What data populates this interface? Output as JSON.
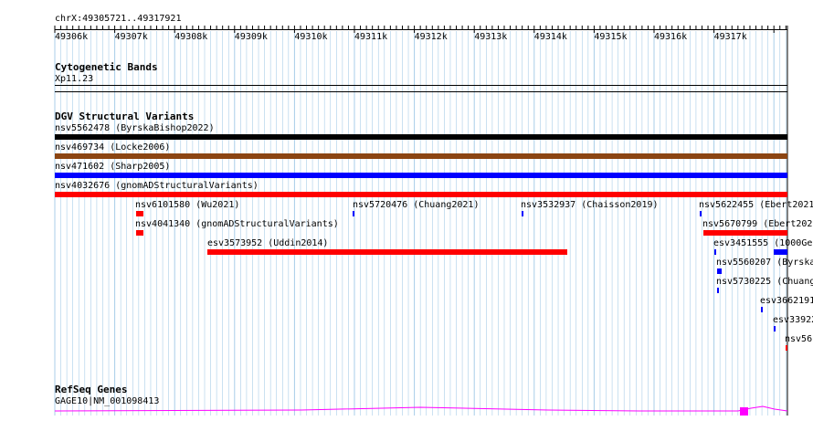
{
  "location": "chrX:49305721..49317921",
  "ruler": {
    "labels": [
      "49306k",
      "49307k",
      "49308k",
      "49309k",
      "49310k",
      "49311k",
      "49312k",
      "49313k",
      "49314k",
      "49315k",
      "49316k",
      "49317k"
    ]
  },
  "tracks": {
    "cytoband": {
      "title": "Cytogenetic Bands",
      "band": "Xp11.23"
    },
    "dgv": {
      "title": "DGV Structural Variants",
      "features": [
        {
          "id": "dgv-1",
          "label": "nsv5562478 (ByrskaBishop2022)",
          "color": "#000000"
        },
        {
          "id": "dgv-2",
          "label": "nsv469734 (Locke2006)",
          "color": "#8b4513"
        },
        {
          "id": "dgv-3",
          "label": "nsv471602 (Sharp2005)",
          "color": "#0000ff"
        },
        {
          "id": "dgv-4",
          "label": "nsv4032676 (gnomADStructuralVariants)",
          "color": "#ff0000"
        },
        {
          "id": "dgv-5",
          "label": "nsv6101580 (Wu2021)",
          "color": "#ff0000"
        },
        {
          "id": "dgv-6",
          "label": "nsv5720476 (Chuang2021)",
          "color": "#0000ff"
        },
        {
          "id": "dgv-7",
          "label": "nsv3532937 (Chaisson2019)",
          "color": "#0000ff"
        },
        {
          "id": "dgv-8",
          "label": "nsv5622455 (Ebert2021",
          "color": "#0000ff"
        },
        {
          "id": "dgv-9",
          "label": "nsv4041340 (gnomADStructuralVariants)",
          "color": "#ff0000"
        },
        {
          "id": "dgv-10",
          "label": "nsv5670799 (Ebert202",
          "color": "#ff0000"
        },
        {
          "id": "dgv-11",
          "label": "esv3573952 (Uddin2014)",
          "color": "#ff0000"
        },
        {
          "id": "dgv-12",
          "label": "esv3451555 (1000Ge",
          "color": "#0000ff"
        },
        {
          "id": "dgv-13",
          "label": "nsv5560207 (Byrska",
          "color": "#0000ff"
        },
        {
          "id": "dgv-14",
          "label": "nsv5730225 (Chuang",
          "color": "#0000ff"
        },
        {
          "id": "dgv-15",
          "label": "esv3662191",
          "color": "#0000ff"
        },
        {
          "id": "dgv-16",
          "label": "esv33922",
          "color": "#0000ff"
        },
        {
          "id": "dgv-17",
          "label": "nsv56",
          "color": "#ff0000"
        }
      ]
    },
    "refseq": {
      "title": "RefSeq Genes",
      "gene": "GAGE10|NM_001098413",
      "color": "#ff00ff"
    }
  }
}
